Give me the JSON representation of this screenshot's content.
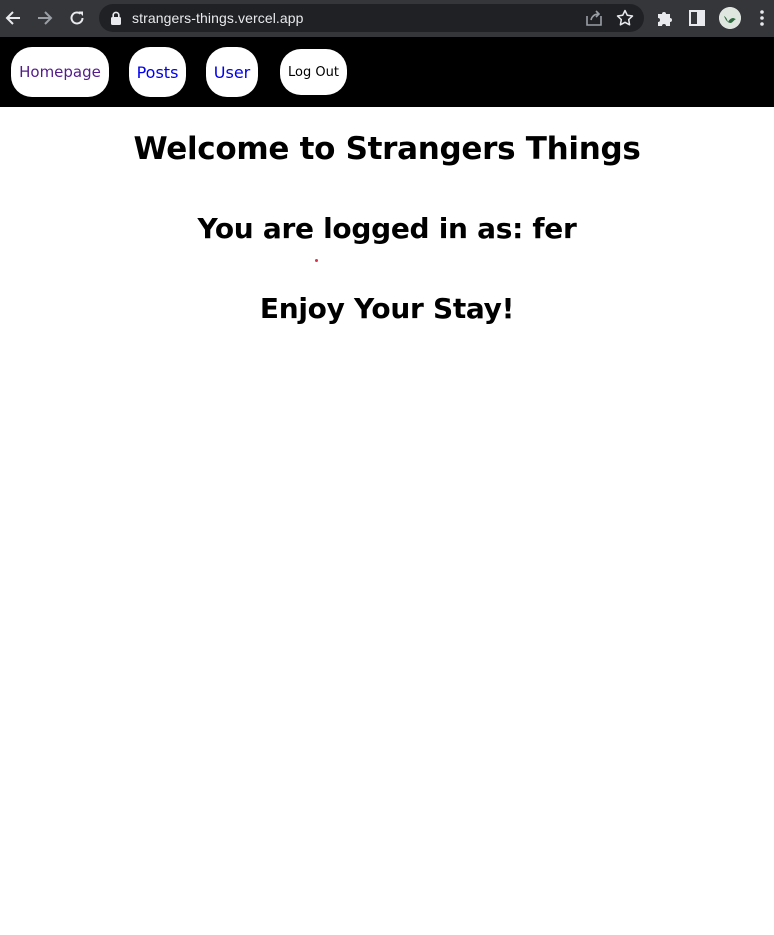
{
  "browser": {
    "url": "strangers-things.vercel.app",
    "icons": {
      "back": "arrow-left",
      "forward": "arrow-right",
      "reload": "reload",
      "lock": "lock",
      "share": "share",
      "bookmark": "star",
      "extensions": "puzzle",
      "side_panel": "side-panel",
      "profile": "avatar",
      "menu": "kebab-menu"
    },
    "colors": {
      "toolbar": "#35363a",
      "omnibox": "#202124",
      "text": "#e8eaed"
    }
  },
  "nav": {
    "background": "#000000",
    "items": [
      {
        "label": "Homepage",
        "color": "#551a8b"
      },
      {
        "label": "Posts",
        "color": "#0000ee"
      },
      {
        "label": "User",
        "color": "#0000ee"
      }
    ],
    "logout_label": "Log Out"
  },
  "main": {
    "welcome": "Welcome to Strangers Things",
    "logged_in": "You are logged in as: fer",
    "enjoy": "Enjoy Your Stay!"
  }
}
